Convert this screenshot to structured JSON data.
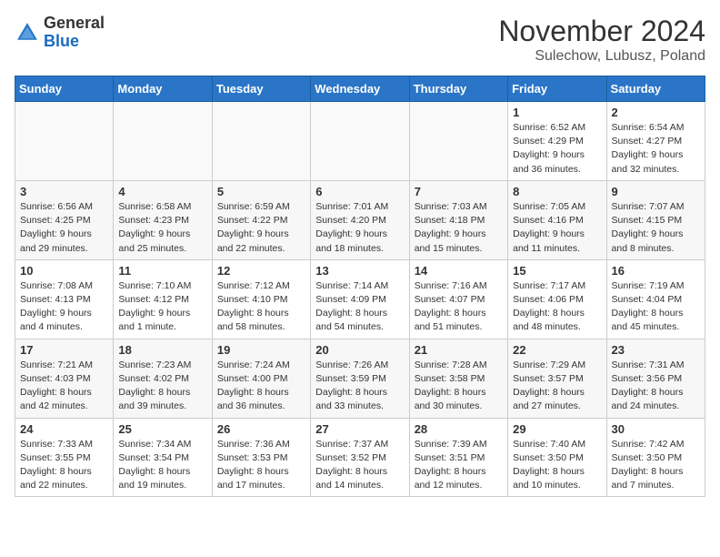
{
  "header": {
    "logo_line1": "General",
    "logo_line2": "Blue",
    "month_year": "November 2024",
    "location": "Sulechow, Lubusz, Poland"
  },
  "days_of_week": [
    "Sunday",
    "Monday",
    "Tuesday",
    "Wednesday",
    "Thursday",
    "Friday",
    "Saturday"
  ],
  "weeks": [
    [
      {
        "day": "",
        "info": ""
      },
      {
        "day": "",
        "info": ""
      },
      {
        "day": "",
        "info": ""
      },
      {
        "day": "",
        "info": ""
      },
      {
        "day": "",
        "info": ""
      },
      {
        "day": "1",
        "info": "Sunrise: 6:52 AM\nSunset: 4:29 PM\nDaylight: 9 hours\nand 36 minutes."
      },
      {
        "day": "2",
        "info": "Sunrise: 6:54 AM\nSunset: 4:27 PM\nDaylight: 9 hours\nand 32 minutes."
      }
    ],
    [
      {
        "day": "3",
        "info": "Sunrise: 6:56 AM\nSunset: 4:25 PM\nDaylight: 9 hours\nand 29 minutes."
      },
      {
        "day": "4",
        "info": "Sunrise: 6:58 AM\nSunset: 4:23 PM\nDaylight: 9 hours\nand 25 minutes."
      },
      {
        "day": "5",
        "info": "Sunrise: 6:59 AM\nSunset: 4:22 PM\nDaylight: 9 hours\nand 22 minutes."
      },
      {
        "day": "6",
        "info": "Sunrise: 7:01 AM\nSunset: 4:20 PM\nDaylight: 9 hours\nand 18 minutes."
      },
      {
        "day": "7",
        "info": "Sunrise: 7:03 AM\nSunset: 4:18 PM\nDaylight: 9 hours\nand 15 minutes."
      },
      {
        "day": "8",
        "info": "Sunrise: 7:05 AM\nSunset: 4:16 PM\nDaylight: 9 hours\nand 11 minutes."
      },
      {
        "day": "9",
        "info": "Sunrise: 7:07 AM\nSunset: 4:15 PM\nDaylight: 9 hours\nand 8 minutes."
      }
    ],
    [
      {
        "day": "10",
        "info": "Sunrise: 7:08 AM\nSunset: 4:13 PM\nDaylight: 9 hours\nand 4 minutes."
      },
      {
        "day": "11",
        "info": "Sunrise: 7:10 AM\nSunset: 4:12 PM\nDaylight: 9 hours\nand 1 minute."
      },
      {
        "day": "12",
        "info": "Sunrise: 7:12 AM\nSunset: 4:10 PM\nDaylight: 8 hours\nand 58 minutes."
      },
      {
        "day": "13",
        "info": "Sunrise: 7:14 AM\nSunset: 4:09 PM\nDaylight: 8 hours\nand 54 minutes."
      },
      {
        "day": "14",
        "info": "Sunrise: 7:16 AM\nSunset: 4:07 PM\nDaylight: 8 hours\nand 51 minutes."
      },
      {
        "day": "15",
        "info": "Sunrise: 7:17 AM\nSunset: 4:06 PM\nDaylight: 8 hours\nand 48 minutes."
      },
      {
        "day": "16",
        "info": "Sunrise: 7:19 AM\nSunset: 4:04 PM\nDaylight: 8 hours\nand 45 minutes."
      }
    ],
    [
      {
        "day": "17",
        "info": "Sunrise: 7:21 AM\nSunset: 4:03 PM\nDaylight: 8 hours\nand 42 minutes."
      },
      {
        "day": "18",
        "info": "Sunrise: 7:23 AM\nSunset: 4:02 PM\nDaylight: 8 hours\nand 39 minutes."
      },
      {
        "day": "19",
        "info": "Sunrise: 7:24 AM\nSunset: 4:00 PM\nDaylight: 8 hours\nand 36 minutes."
      },
      {
        "day": "20",
        "info": "Sunrise: 7:26 AM\nSunset: 3:59 PM\nDaylight: 8 hours\nand 33 minutes."
      },
      {
        "day": "21",
        "info": "Sunrise: 7:28 AM\nSunset: 3:58 PM\nDaylight: 8 hours\nand 30 minutes."
      },
      {
        "day": "22",
        "info": "Sunrise: 7:29 AM\nSunset: 3:57 PM\nDaylight: 8 hours\nand 27 minutes."
      },
      {
        "day": "23",
        "info": "Sunrise: 7:31 AM\nSunset: 3:56 PM\nDaylight: 8 hours\nand 24 minutes."
      }
    ],
    [
      {
        "day": "24",
        "info": "Sunrise: 7:33 AM\nSunset: 3:55 PM\nDaylight: 8 hours\nand 22 minutes."
      },
      {
        "day": "25",
        "info": "Sunrise: 7:34 AM\nSunset: 3:54 PM\nDaylight: 8 hours\nand 19 minutes."
      },
      {
        "day": "26",
        "info": "Sunrise: 7:36 AM\nSunset: 3:53 PM\nDaylight: 8 hours\nand 17 minutes."
      },
      {
        "day": "27",
        "info": "Sunrise: 7:37 AM\nSunset: 3:52 PM\nDaylight: 8 hours\nand 14 minutes."
      },
      {
        "day": "28",
        "info": "Sunrise: 7:39 AM\nSunset: 3:51 PM\nDaylight: 8 hours\nand 12 minutes."
      },
      {
        "day": "29",
        "info": "Sunrise: 7:40 AM\nSunset: 3:50 PM\nDaylight: 8 hours\nand 10 minutes."
      },
      {
        "day": "30",
        "info": "Sunrise: 7:42 AM\nSunset: 3:50 PM\nDaylight: 8 hours\nand 7 minutes."
      }
    ]
  ]
}
